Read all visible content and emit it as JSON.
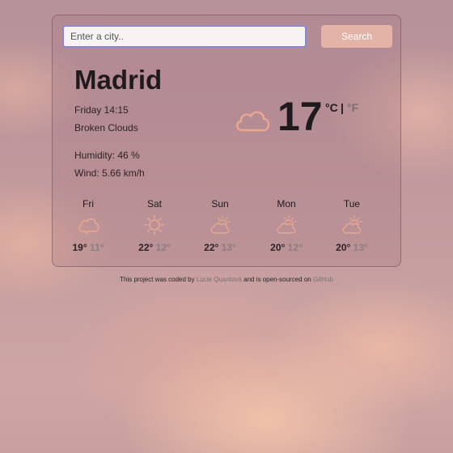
{
  "search": {
    "placeholder": "Enter a city..",
    "button_label": "Search"
  },
  "current": {
    "city": "Madrid",
    "datetime": "Friday 14:15",
    "condition": "Broken Clouds",
    "humidity": "Humidity: 46 %",
    "wind": "Wind: 5.66 km/h",
    "temperature": "17",
    "icon": "cloud-icon",
    "unit_celsius": "°C",
    "unit_separator": "|",
    "unit_fahrenheit": "°F"
  },
  "forecast": [
    {
      "day": "Fri",
      "icon": "cloud-icon",
      "max": "19°",
      "min": "11°"
    },
    {
      "day": "Sat",
      "icon": "sun-icon",
      "max": "22°",
      "min": "12°"
    },
    {
      "day": "Sun",
      "icon": "partly-cloudy-icon",
      "max": "22°",
      "min": "13°"
    },
    {
      "day": "Mon",
      "icon": "partly-cloudy-icon",
      "max": "20°",
      "min": "12°"
    },
    {
      "day": "Tue",
      "icon": "partly-cloudy-icon",
      "max": "20°",
      "min": "13°"
    }
  ],
  "footer": {
    "text_1": "This project was coded by",
    "author_link": "Lucie Quantová",
    "text_2": "and is open-sourced on",
    "github_link": "GitHub"
  },
  "colors": {
    "accent_button": "#e4b3a8",
    "icon_stroke": "#e8a78f",
    "input_border": "#8a86d6"
  }
}
